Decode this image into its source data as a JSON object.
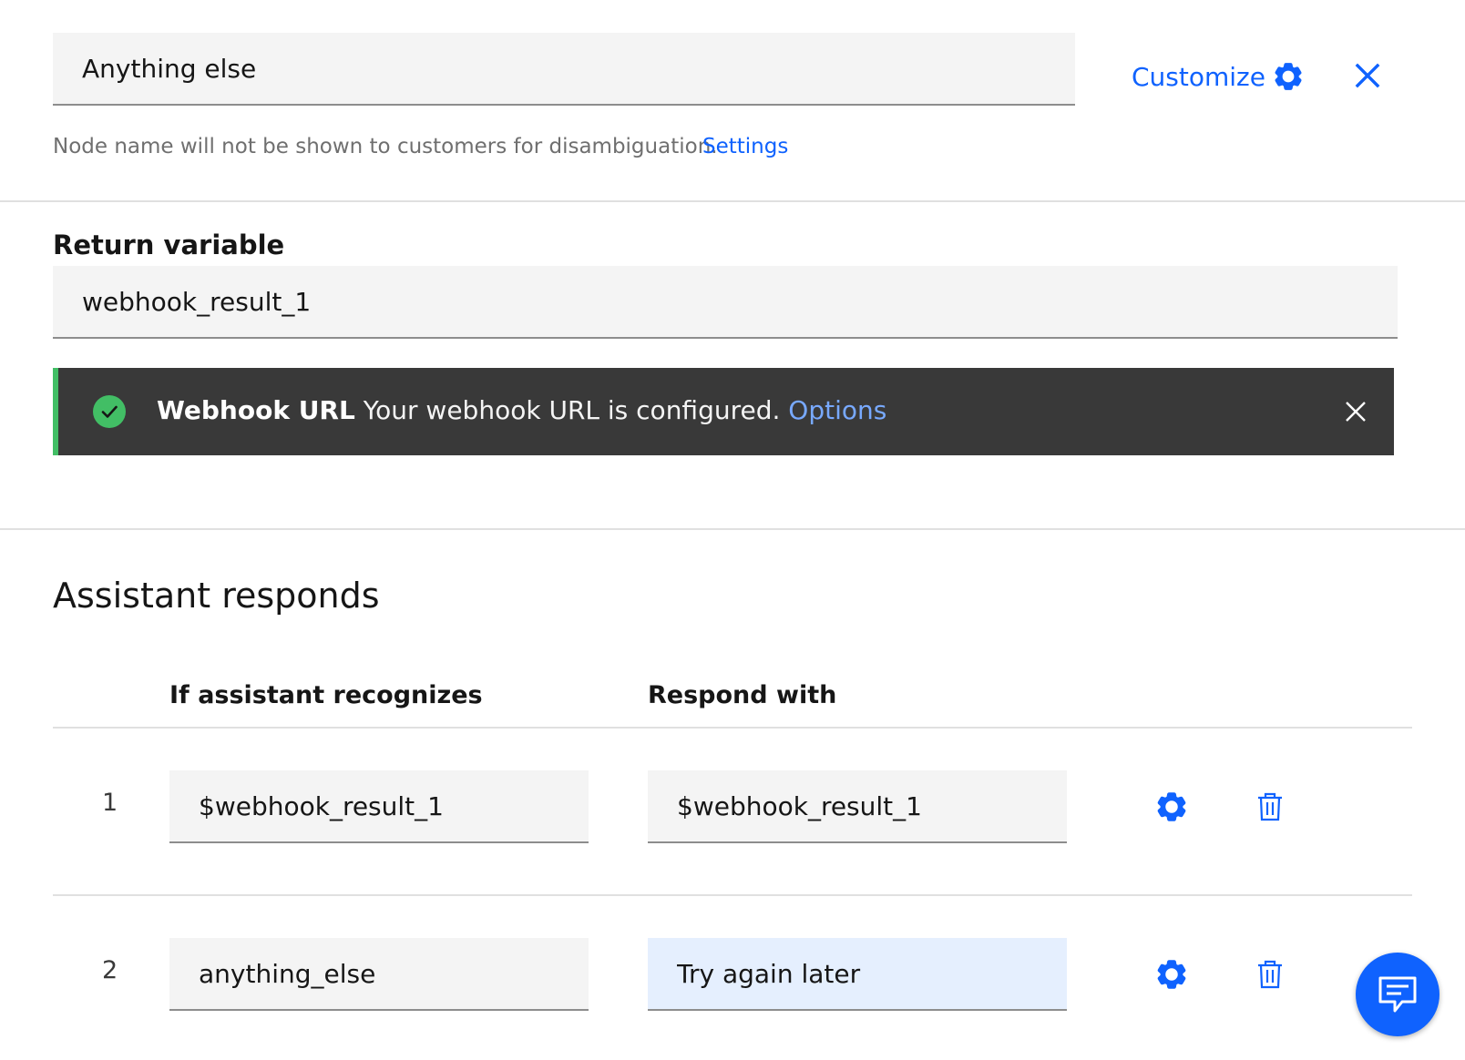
{
  "node": {
    "name_value": "Anything else",
    "customize_label": "Customize",
    "helper_text": "Node name will not be shown to customers for disambiguation.",
    "settings_link": "Settings"
  },
  "return_variable": {
    "label": "Return variable",
    "value": "webhook_result_1"
  },
  "notification": {
    "title": "Webhook URL",
    "message": "Your webhook URL is configured.",
    "link": "Options",
    "status_color": "#42be65",
    "icon": "checkmark-filled-icon"
  },
  "responses": {
    "title": "Assistant responds",
    "col_condition": "If assistant recognizes",
    "col_response": "Respond with",
    "rows": [
      {
        "number": "1",
        "condition": "$webhook_result_1",
        "response": "$webhook_result_1"
      },
      {
        "number": "2",
        "condition": "anything_else",
        "response": "Try again later"
      }
    ]
  },
  "colors": {
    "accent": "#0f62fe",
    "field_bg": "#f4f4f4",
    "active_field_bg": "#e5effe",
    "notification_bg": "#393939"
  },
  "icons": [
    "gear-icon",
    "close-icon",
    "trash-icon",
    "chat-icon"
  ]
}
